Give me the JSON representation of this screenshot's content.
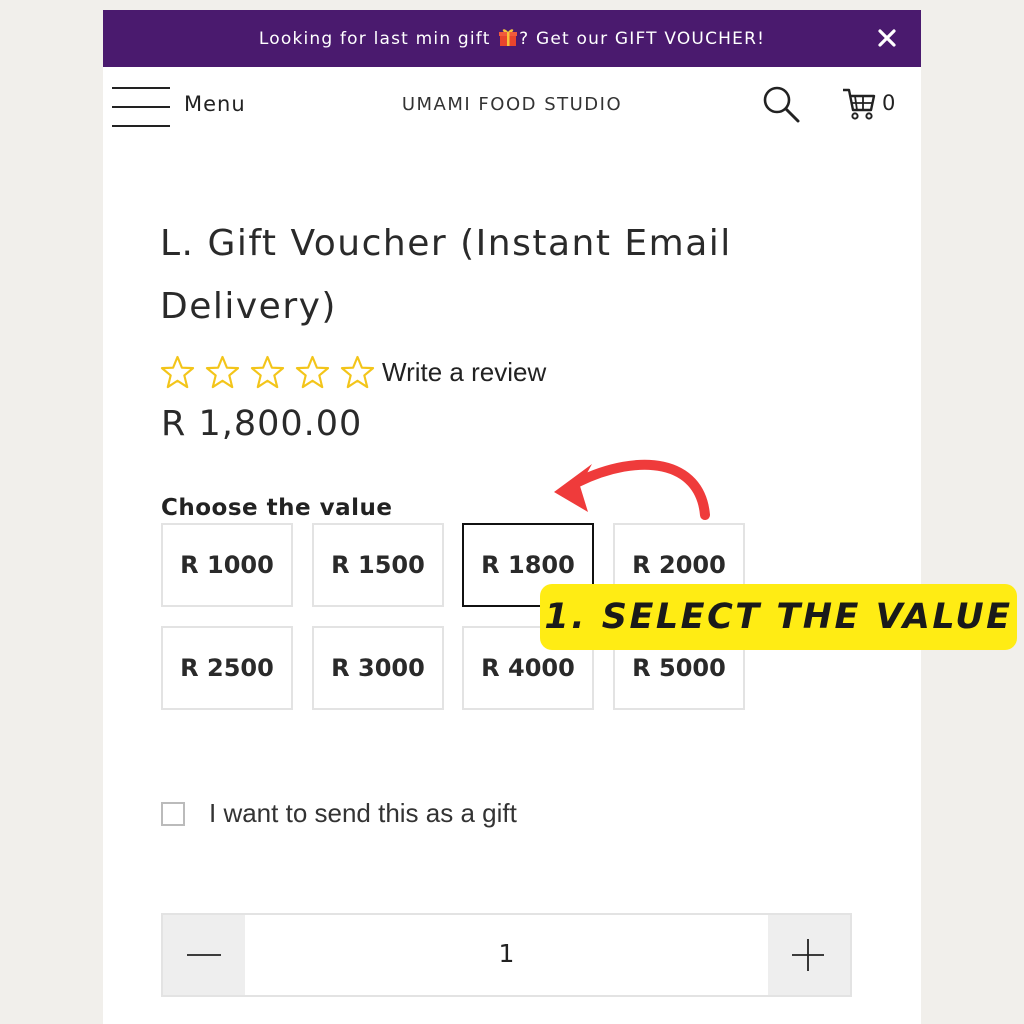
{
  "colors": {
    "announcement_bg": "#4a1a6e",
    "page_bg": "#f1efeb",
    "star_outline": "#f3c51a",
    "callout_bg": "#ffec14",
    "arrow": "#ef3b3b"
  },
  "announcement": {
    "text_before": "Looking for last min gift",
    "text_after": "? Get our GIFT VOUCHER!",
    "gift_icon": "gift-icon",
    "close_icon": "close-icon"
  },
  "header": {
    "menu_label": "Menu",
    "brand": "UMAMI FOOD STUDIO",
    "search_icon": "search-icon",
    "cart_icon": "cart-icon",
    "cart_count": "0"
  },
  "product": {
    "title": "L. Gift Voucher (Instant Email Delivery)",
    "rating_stars": 0,
    "rating_max": 5,
    "review_link": "Write a review",
    "price": "R 1,800.00"
  },
  "options": {
    "label": "Choose the value",
    "values": [
      "R 1000",
      "R 1500",
      "R 1800",
      "R 2000",
      "R 2500",
      "R 3000",
      "R 4000",
      "R 5000"
    ],
    "selected": "R 1800"
  },
  "gift_option": {
    "label": "I want to send this as a gift",
    "checked": false
  },
  "quantity": {
    "value": "1"
  },
  "tutorial": {
    "callout": "1. SELECT THE VALUE"
  }
}
